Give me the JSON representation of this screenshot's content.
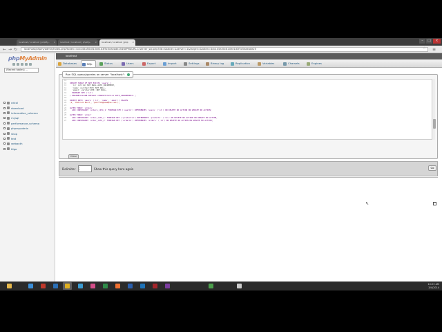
{
  "browser": {
    "tabs": [
      {
        "title": "localhost / localhost | phpMy..."
      },
      {
        "title": "localhost / localhost | phpMy..."
      },
      {
        "title": "localhost / localhost | php"
      }
    ],
    "address": "localhost/phpmyadmin/index.php?token=4cb145a50c810ee1d3f5c5eaeade254f#PMAURL-1:server_sql.php?db=&table=&server=1&target=&token=4cb145a50c810ee1d3f5c5eaeade25"
  },
  "left_panel": {
    "logo_php": "php",
    "logo_my": "MyAdmin",
    "recent_placeholder": "(Recent tables) ...",
    "databases": [
      "cdcol",
      "download",
      "information_schema",
      "mysql",
      "performance_schema",
      "phpmyadmin",
      "shop",
      "test",
      "webauth",
      "tilgo"
    ]
  },
  "right_panel": {
    "server_label": "localhost",
    "tabs": [
      {
        "label": "Databases",
        "icon": "database-icon",
        "color": "#d9a33a"
      },
      {
        "label": "SQL",
        "icon": "sql-icon",
        "color": "#5b7fb6",
        "active": true
      },
      {
        "label": "Status",
        "icon": "status-icon",
        "color": "#5aa05a"
      },
      {
        "label": "Users",
        "icon": "users-icon",
        "color": "#7a6ab0"
      },
      {
        "label": "Export",
        "icon": "export-icon",
        "color": "#c66"
      },
      {
        "label": "Import",
        "icon": "import-icon",
        "color": "#6a9fd4"
      },
      {
        "label": "Settings",
        "icon": "settings-icon",
        "color": "#888"
      },
      {
        "label": "Binary log",
        "icon": "binary-log-icon",
        "color": "#a86"
      },
      {
        "label": "Replication",
        "icon": "replication-icon",
        "color": "#6ab"
      },
      {
        "label": "Variables",
        "icon": "variables-icon",
        "color": "#b96"
      },
      {
        "label": "Charsets",
        "icon": "charsets-icon",
        "color": "#79a"
      },
      {
        "label": "Engines",
        "icon": "engines-icon",
        "color": "#9a7"
      }
    ],
    "run_legend": "Run SQL query/queries on server \"localhost\":",
    "sql_lines": [
      {
        "n": "11",
        "text": ""
      },
      {
        "n": "12",
        "text": "CREATE TABLE IF NOT EXISTS `users` ("
      },
      {
        "n": "13",
        "text": "  `id` int(11) NOT NULL AUTO_INCREMENT,"
      },
      {
        "n": "14",
        "text": "  `name` varchar(255) NOT NULL,"
      },
      {
        "n": "15",
        "text": "  `email` varchar(255) NOT NULL,"
      },
      {
        "n": "16",
        "text": "  PRIMARY KEY (`id`)"
      },
      {
        "n": "17",
        "text": ") ENGINE=InnoDB DEFAULT CHARSET=latin1 AUTO_INCREMENT=1 ;"
      },
      {
        "n": "18",
        "text": ""
      },
      {
        "n": "19",
        "text": "INSERT INTO `users` (`id`, `name`, `email`) VALUES"
      },
      {
        "n": "20",
        "text": "(1, 'Patrick Bird', 'patrick@example.com');"
      },
      {
        "n": "21",
        "text": ""
      },
      {
        "n": "22",
        "text": "ALTER TABLE `orders`"
      },
      {
        "n": "23",
        "text": "  ADD CONSTRAINT `orders_ibfk_1` FOREIGN KEY (`userid`) REFERENCES `users` (`id`) ON DELETE NO ACTION ON UPDATE NO ACTION;"
      },
      {
        "n": "24",
        "text": ""
      },
      {
        "n": "25",
        "text": "ALTER TABLE `order`"
      },
      {
        "n": "26",
        "text": "  ADD CONSTRAINT `order_ibfk_1` FOREIGN KEY (`productid`) REFERENCES `products` (`id`) ON DELETE NO ACTION ON UPDATE NO ACTION,"
      },
      {
        "n": "27",
        "text": "  ADD CONSTRAINT `order_ibfk_2` FOREIGN KEY (`orderid`) REFERENCES `orders` (`id`) ON DELETE NO ACTION ON UPDATE NO ACTION;"
      }
    ],
    "clear_label": "Clear",
    "delimiter_label": "Delimiter",
    "delimiter_value": ";",
    "option_text": "Show this query here again",
    "go_label": "Go"
  },
  "taskbar": {
    "apps": [
      {
        "icon": "file-explorer-icon",
        "color": "#e6b84c"
      },
      {
        "icon": "ie-icon",
        "color": "#3b8ed8"
      },
      {
        "icon": "filezilla-icon",
        "color": "#c0392b"
      },
      {
        "icon": "photoshop-icon",
        "color": "#2b6fb5"
      },
      {
        "icon": "chrome-icon",
        "color": "#e0b020",
        "active": true
      },
      {
        "icon": "paint-icon",
        "color": "#3b9bd1"
      },
      {
        "icon": "store-icon",
        "color": "#d64f8a"
      },
      {
        "icon": "excel-icon",
        "color": "#2e8a48"
      },
      {
        "icon": "xampp-icon",
        "color": "#f07030"
      },
      {
        "icon": "word-icon",
        "color": "#2a5fae"
      },
      {
        "icon": "outlook-icon",
        "color": "#1f73b7"
      },
      {
        "icon": "access-icon",
        "color": "#a4262c"
      },
      {
        "icon": "onenote-icon",
        "color": "#7b3c9f"
      },
      {
        "icon": "chrome-2-icon",
        "color": "#4c9f4c"
      },
      {
        "icon": "terminal-icon",
        "color": "#cccccc"
      }
    ],
    "time": "10:23 AM",
    "date": "3/4/2014"
  }
}
